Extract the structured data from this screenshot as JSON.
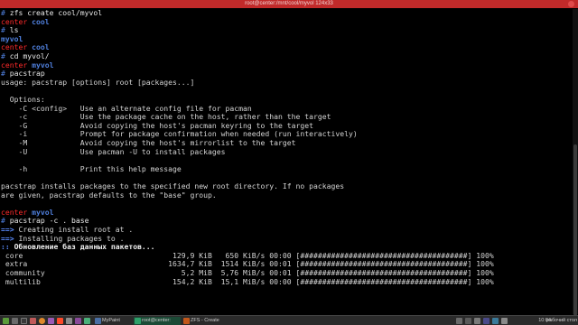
{
  "window": {
    "title": "root@center:/mnt/cool/myvol 124x33"
  },
  "terminal": {
    "lines": [
      {
        "prefix": "# ",
        "cmd": "zfs create cool/myvol"
      },
      {
        "host": "center",
        "path": "cool"
      },
      {
        "prefix": "# ",
        "cmd": "ls"
      },
      {
        "text": "myvol",
        "cls": "path"
      },
      {
        "host": "center",
        "path": "cool"
      },
      {
        "prefix": "# ",
        "cmd": "cd myvol/"
      },
      {
        "host": "center",
        "path": "myvol"
      },
      {
        "prefix": "# ",
        "cmd": "pacstrap"
      },
      {
        "text": "usage: pacstrap [options] root [packages...]"
      },
      {
        "text": ""
      },
      {
        "text": "  Options:"
      },
      {
        "text": "    -C <config>   Use an alternate config file for pacman"
      },
      {
        "text": "    -c            Use the package cache on the host, rather than the target"
      },
      {
        "text": "    -G            Avoid copying the host's pacman keyring to the target"
      },
      {
        "text": "    -i            Prompt for package confirmation when needed (run interactively)"
      },
      {
        "text": "    -M            Avoid copying the host's mirrorlist to the target"
      },
      {
        "text": "    -U            Use pacman -U to install packages"
      },
      {
        "text": ""
      },
      {
        "text": "    -h            Print this help message"
      },
      {
        "text": ""
      },
      {
        "text": "pacstrap installs packages to the specified new root directory. If no packages"
      },
      {
        "text": "are given, pacstrap defaults to the \"base\" group."
      },
      {
        "text": ""
      },
      {
        "host": "center",
        "path": "myvol"
      },
      {
        "prefix": "# ",
        "cmd": "pacstrap -c . base"
      },
      {
        "arrow": "==>",
        "text": " Creating install root at ."
      },
      {
        "arrow": "==>",
        "text": " Installing packages to ."
      },
      {
        "dots": "::",
        "text": " Обновление баз данных пакетов...",
        "cls": "bold"
      },
      {
        "text": " core                                  129,9 KiB   650 KiB/s 00:00 [######################################] 100%"
      },
      {
        "text": " extra                                1634,7 KiB  1514 KiB/s 00:01 [######################################] 100%"
      },
      {
        "text": " community                               5,2 MiB  5,76 MiB/s 00:01 [######################################] 100%"
      },
      {
        "text": " multilib                              154,2 KiB  15,1 MiB/s 00:00 [######################################] 100%"
      }
    ]
  },
  "taskbar": {
    "tasks": [
      {
        "label": "MyPaint",
        "color": "#4a6fa5"
      },
      {
        "label": "root@center:",
        "color": "#1e5a3a"
      },
      {
        "label": "ZFS - Create",
        "color": "#c2571a"
      }
    ],
    "clock": "10:04",
    "desktop": "рабочий стол"
  }
}
